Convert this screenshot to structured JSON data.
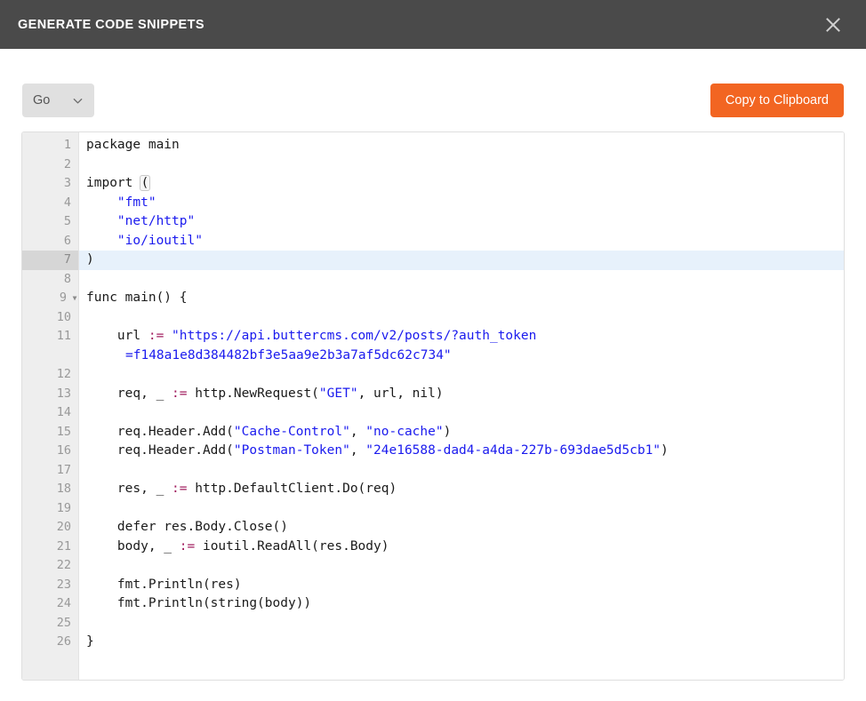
{
  "header": {
    "title": "GENERATE CODE SNIPPETS",
    "close_icon": "close-icon"
  },
  "toolbar": {
    "language_selected": "Go",
    "language_options": [
      "Go"
    ],
    "dropdown_icon": "chevron-down-icon",
    "copy_label": "Copy to Clipboard",
    "accent_color": "#f26522"
  },
  "editor": {
    "language": "go",
    "active_line": 7,
    "fold_lines": [
      9
    ],
    "line_numbers": [
      "1",
      "2",
      "3",
      "4",
      "5",
      "6",
      "7",
      "8",
      "9",
      "10",
      "11",
      "12",
      "13",
      "14",
      "15",
      "16",
      "17",
      "18",
      "19",
      "20",
      "21",
      "22",
      "23",
      "24",
      "25",
      "26"
    ],
    "highlight_colors": {
      "string": "#1a1aee",
      "operator": "#a11c5e",
      "text": "#1a1a1a",
      "active_line_bg": "#e7f1fb",
      "gutter_bg": "#eeeeee"
    },
    "values": {
      "url": "https://api.buttercms.com/v2/posts/?auth_token=f148a1e8d384482bf3e5aa9e2b3a7af5dc62c734",
      "url_part1": "\"https://api.buttercms.com/v2/posts/?auth_token",
      "url_part2": "=f148a1e8d384482bf3e5aa9e2b3a7af5dc62c734\"",
      "method": "\"GET\"",
      "header1_name": "\"Cache-Control\"",
      "header1_value": "\"no-cache\"",
      "header2_name": "\"Postman-Token\"",
      "header2_value": "\"24e16588-dad4-a4da-227b-693dae5d5cb1\"",
      "import_fmt": "\"fmt\"",
      "import_nethttp": "\"net/http\"",
      "import_ioioutil": "\"io/ioutil\""
    },
    "lines": {
      "l1": "package main",
      "l2": "",
      "l3_a": "import ",
      "l3_b": "(",
      "l7": ")",
      "l8": "",
      "l9": "func main() {",
      "l10": "",
      "l11_a": "    url ",
      "l11_op": ":=",
      "l11_b": " ",
      "l12": "",
      "l13_a": "    req, _ ",
      "l13_op": ":=",
      "l13_b": " http.NewRequest(",
      "l13_c": ", url, nil)",
      "l14": "",
      "l15_a": "    req.Header.Add(",
      "l15_mid": ", ",
      "l15_end": ")",
      "l16_a": "    req.Header.Add(",
      "l16_mid": ", ",
      "l16_end": ")",
      "l17": "",
      "l18_a": "    res, _ ",
      "l18_op": ":=",
      "l18_b": " http.DefaultClient.Do(req)",
      "l19": "",
      "l20": "    defer res.Body.Close()",
      "l21_a": "    body, _ ",
      "l21_op": ":=",
      "l21_b": " ioutil.ReadAll(res.Body)",
      "l22": "",
      "l23": "    fmt.Println(res)",
      "l24": "    fmt.Println(string(body))",
      "l25": "",
      "l26": "}"
    }
  }
}
